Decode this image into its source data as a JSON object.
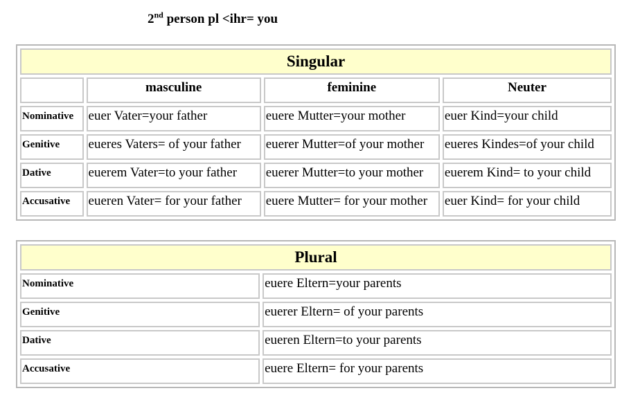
{
  "title": {
    "number": "2",
    "ordinal_suffix": "nd",
    "rest": " person pl <ihr= you"
  },
  "singular": {
    "heading": "Singular",
    "columns": [
      "masculine",
      "feminine",
      "Neuter"
    ],
    "rows": [
      {
        "case": "Nominative",
        "forms": [
          "euer Vater=your father",
          "euere Mutter=your mother",
          "euer Kind=your child"
        ]
      },
      {
        "case": "Genitive",
        "forms": [
          "eueres Vaters= of your father",
          "euerer Mutter=of your mother",
          "eueres Kindes=of your child"
        ]
      },
      {
        "case": "Dative",
        "forms": [
          "euerem Vater=to your father",
          "euerer Mutter=to your mother",
          "euerem Kind= to your child"
        ]
      },
      {
        "case": "Accusative",
        "forms": [
          "eueren Vater= for your father",
          "euere Mutter= for your mother",
          "euer Kind= for your child"
        ]
      }
    ]
  },
  "plural": {
    "heading": "Plural",
    "rows": [
      {
        "case": "Nominative",
        "form": "euere Eltern=your parents"
      },
      {
        "case": "Genitive",
        "form": "euerer Eltern= of your parents"
      },
      {
        "case": "Dative",
        "form": "eueren Eltern=to your parents"
      },
      {
        "case": "Accusative",
        "form": "euere Eltern= for your parents"
      }
    ]
  }
}
